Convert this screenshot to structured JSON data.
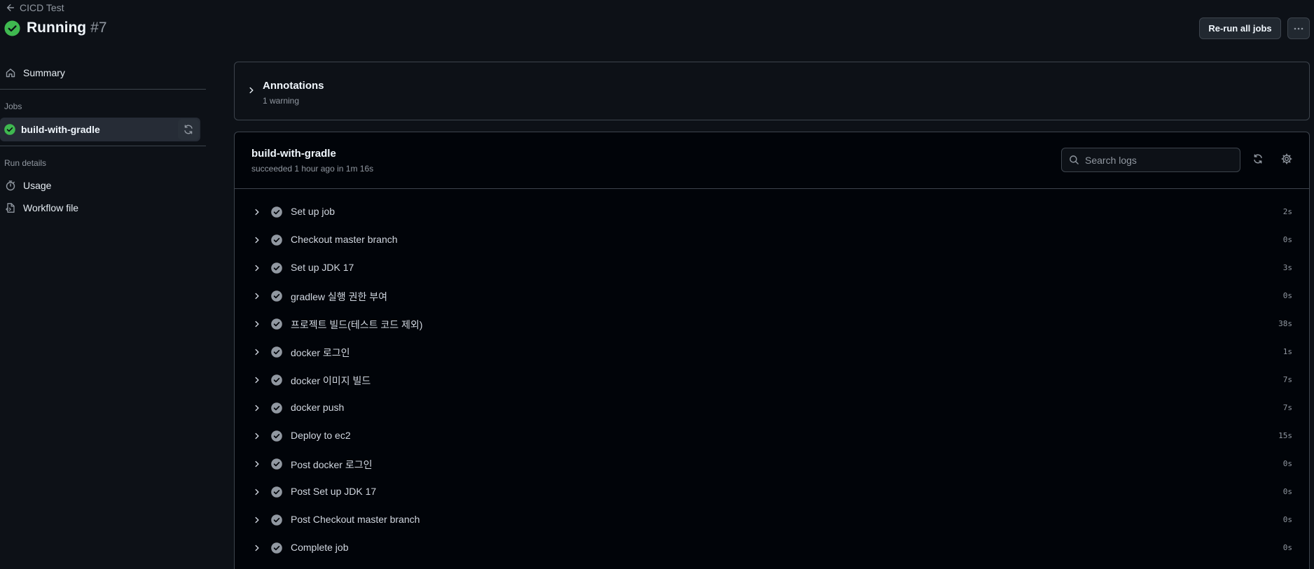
{
  "header": {
    "back_label": "CICD Test",
    "title": "Running",
    "run_number": "#7",
    "rerun_label": "Re-run all jobs",
    "more_label": "···"
  },
  "sidebar": {
    "summary_label": "Summary",
    "jobs_heading": "Jobs",
    "job_name": "build-with-gradle",
    "run_details_heading": "Run details",
    "usage_label": "Usage",
    "workflow_file_label": "Workflow file"
  },
  "annotations": {
    "title": "Annotations",
    "subtitle": "1 warning"
  },
  "job": {
    "title": "build-with-gradle",
    "subtitle": "succeeded 1 hour ago in 1m 16s",
    "search_placeholder": "Search logs",
    "steps": [
      {
        "label": "Set up job",
        "time": "2s"
      },
      {
        "label": "Checkout master branch",
        "time": "0s"
      },
      {
        "label": "Set up JDK 17",
        "time": "3s"
      },
      {
        "label": "gradlew 실행 권한 부여",
        "time": "0s"
      },
      {
        "label": "프로젝트 빌드(테스트 코드 제외)",
        "time": "38s"
      },
      {
        "label": "docker 로그인",
        "time": "1s"
      },
      {
        "label": "docker 이미지 빌드",
        "time": "7s"
      },
      {
        "label": "docker push",
        "time": "7s"
      },
      {
        "label": "Deploy to ec2",
        "time": "15s"
      },
      {
        "label": "Post docker 로그인",
        "time": "0s"
      },
      {
        "label": "Post Set up JDK 17",
        "time": "0s"
      },
      {
        "label": "Post Checkout master branch",
        "time": "0s"
      },
      {
        "label": "Complete job",
        "time": "0s"
      }
    ]
  },
  "colors": {
    "success": "#3fb950",
    "background": "#0d1117",
    "panel": "#010409",
    "border": "#3d444d",
    "muted": "#9198a1"
  }
}
